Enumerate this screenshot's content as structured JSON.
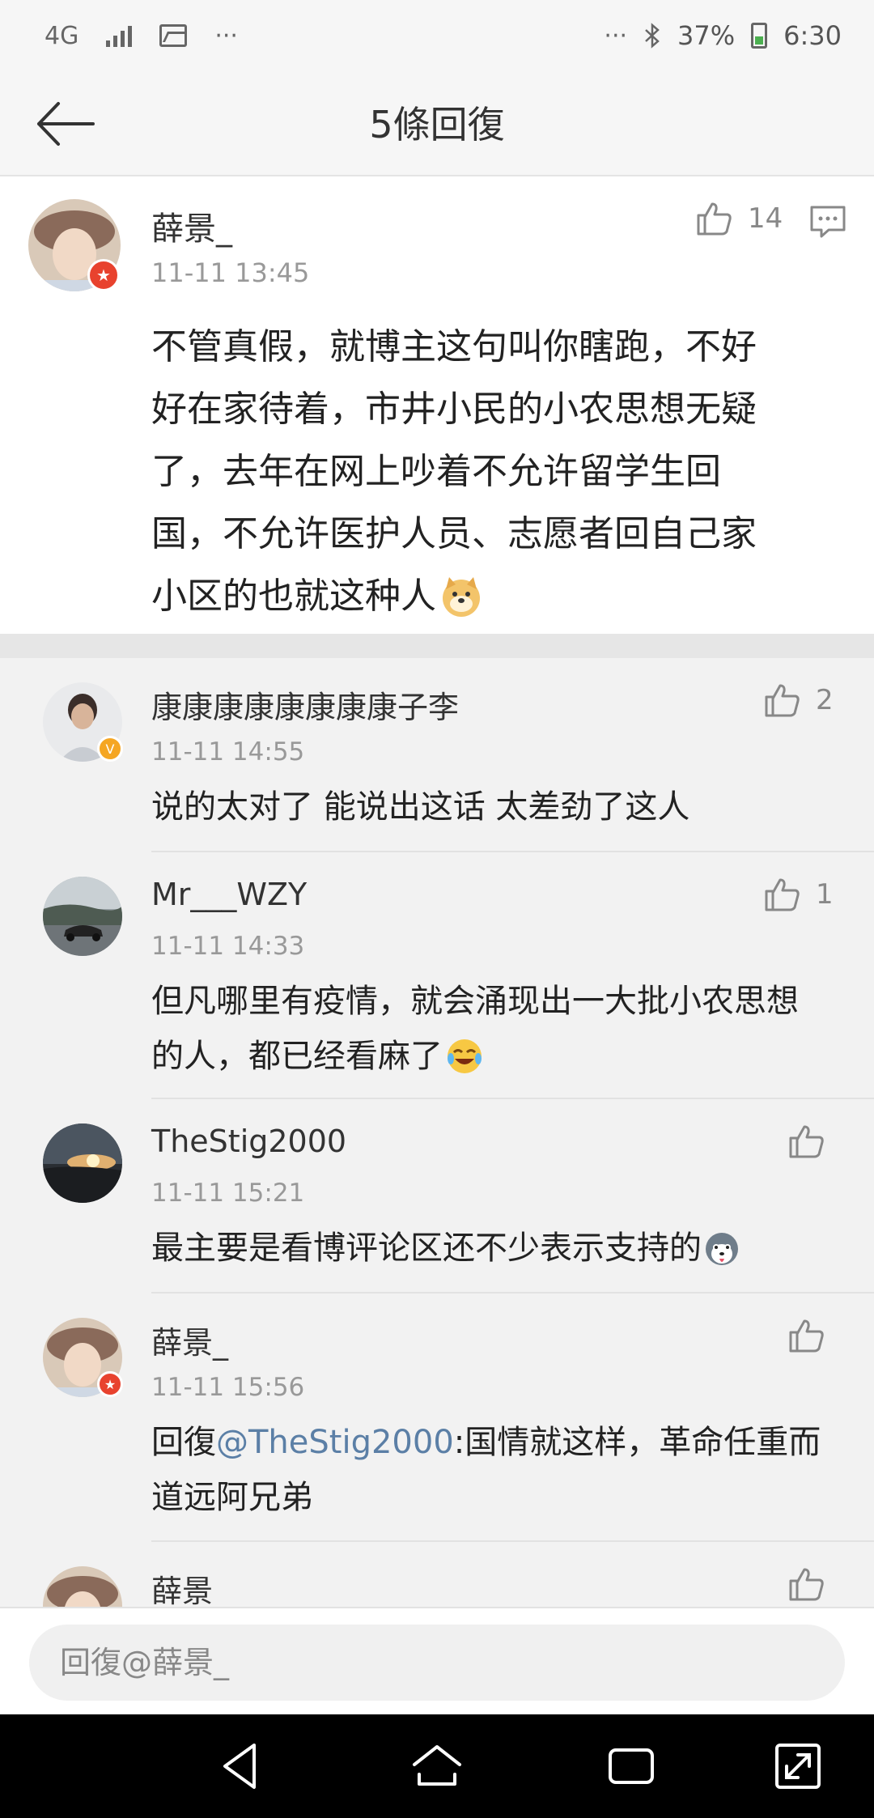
{
  "status_bar": {
    "network": "4G",
    "more": "···",
    "more_right": "···",
    "battery": "37%",
    "time": "6:30"
  },
  "header": {
    "title": "5條回復"
  },
  "main_comment": {
    "author": "薛景_",
    "time": "11-11 13:45",
    "likes": "14",
    "text_lines": [
      "不管真假，就博主这句叫你瞎跑，不好",
      "好在家待着，市井小民的小农思想无疑",
      "了，去年在网上吵着不允许留学生回",
      "国，不允许医护人员、志愿者回自己家",
      "小区的也就这种人"
    ]
  },
  "replies": [
    {
      "author": "康康康康康康康康子李",
      "time": "11-11 14:55",
      "likes": "2",
      "text_lines": [
        "说的太对了 能说出这话 太差劲了这人"
      ]
    },
    {
      "author": "Mr___WZY",
      "time": "11-11 14:33",
      "likes": "1",
      "text_lines": [
        "但凡哪里有疫情，就会涌现出一大批小农思想",
        "的人，都已经看麻了"
      ]
    },
    {
      "author": "TheStig2000",
      "time": "11-11 15:21",
      "likes": "",
      "text_lines": [
        "最主要是看博评论区还不少表示支持的"
      ]
    },
    {
      "author": "薛景_",
      "time": "11-11 15:56",
      "likes": "",
      "prefix": "回復",
      "mention": "@TheStig2000",
      "rest": ":国情就这样，革命任重而",
      "line2": "道远阿兄弟"
    },
    {
      "author": "薛景_"
    }
  ],
  "input": {
    "placeholder": "回復@薛景_"
  },
  "colors": {
    "mention": "#5b7fa6",
    "badge_red": "#e8422e",
    "badge_gold": "#f5a623"
  }
}
